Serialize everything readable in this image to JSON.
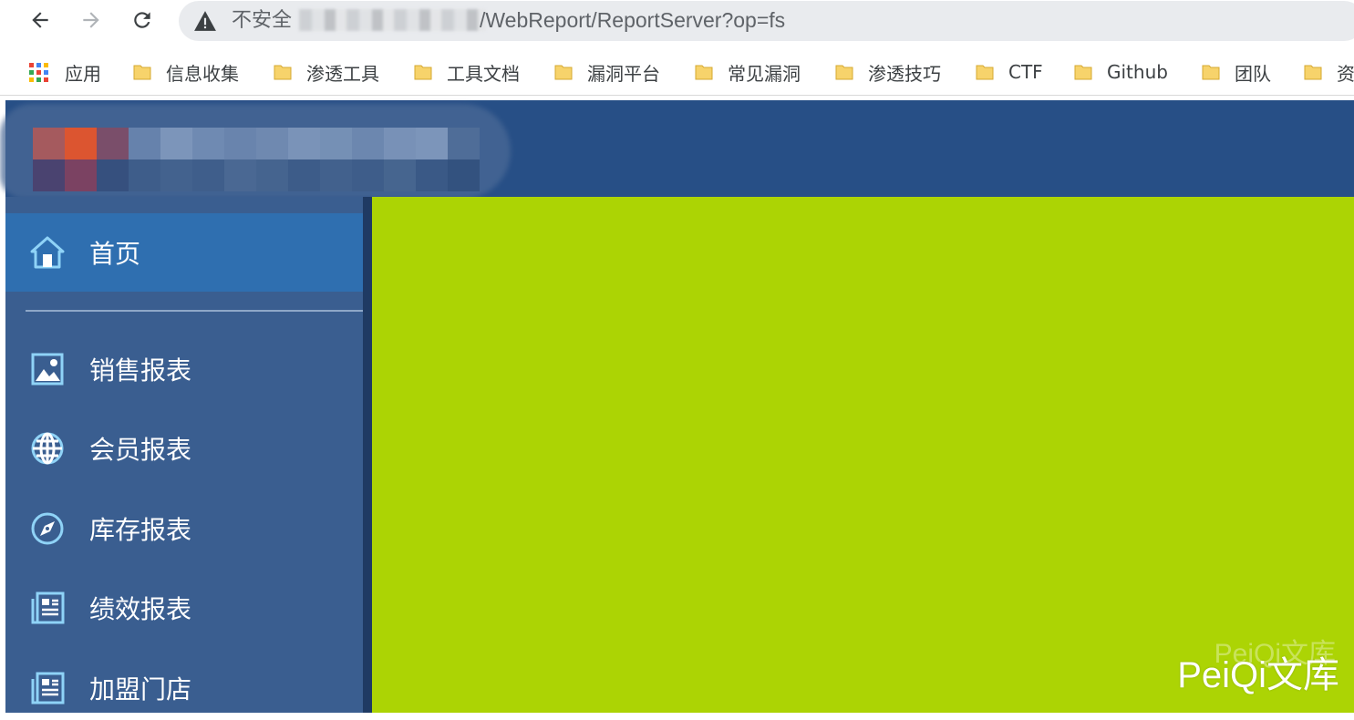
{
  "browser": {
    "security_label": "不安全",
    "url_visible": "/WebReport/ReportServer?op=fs"
  },
  "bookmarks": [
    {
      "label": "应用",
      "icon": "apps-grid-icon"
    },
    {
      "label": "信息收集",
      "icon": "folder-icon"
    },
    {
      "label": "渗透工具",
      "icon": "folder-icon"
    },
    {
      "label": "工具文档",
      "icon": "folder-icon"
    },
    {
      "label": "漏洞平台",
      "icon": "folder-icon"
    },
    {
      "label": "常见漏洞",
      "icon": "folder-icon"
    },
    {
      "label": "渗透技巧",
      "icon": "folder-icon"
    },
    {
      "label": "CTF",
      "icon": "folder-icon"
    },
    {
      "label": "Github",
      "icon": "folder-icon"
    },
    {
      "label": "团队",
      "icon": "folder-icon"
    },
    {
      "label": "资",
      "icon": "folder-icon"
    }
  ],
  "sidebar": {
    "home": {
      "label": "首页",
      "icon": "home-icon"
    },
    "items": [
      {
        "label": "销售报表",
        "icon": "image-report-icon"
      },
      {
        "label": "会员报表",
        "icon": "globe-icon"
      },
      {
        "label": "库存报表",
        "icon": "compass-icon"
      },
      {
        "label": "绩效报表",
        "icon": "document-icon"
      },
      {
        "label": "加盟门店",
        "icon": "document-icon"
      }
    ]
  },
  "watermark": {
    "text": "PeiQi文库",
    "ghost_text": "PeiQi文库"
  },
  "colors": {
    "header_bg": "#274f86",
    "sidebar_bg": "#3a5e90",
    "sidebar_active": "#2f6fb0",
    "content_bg": "#acd404",
    "folder_yellow": "#f7d36b"
  }
}
